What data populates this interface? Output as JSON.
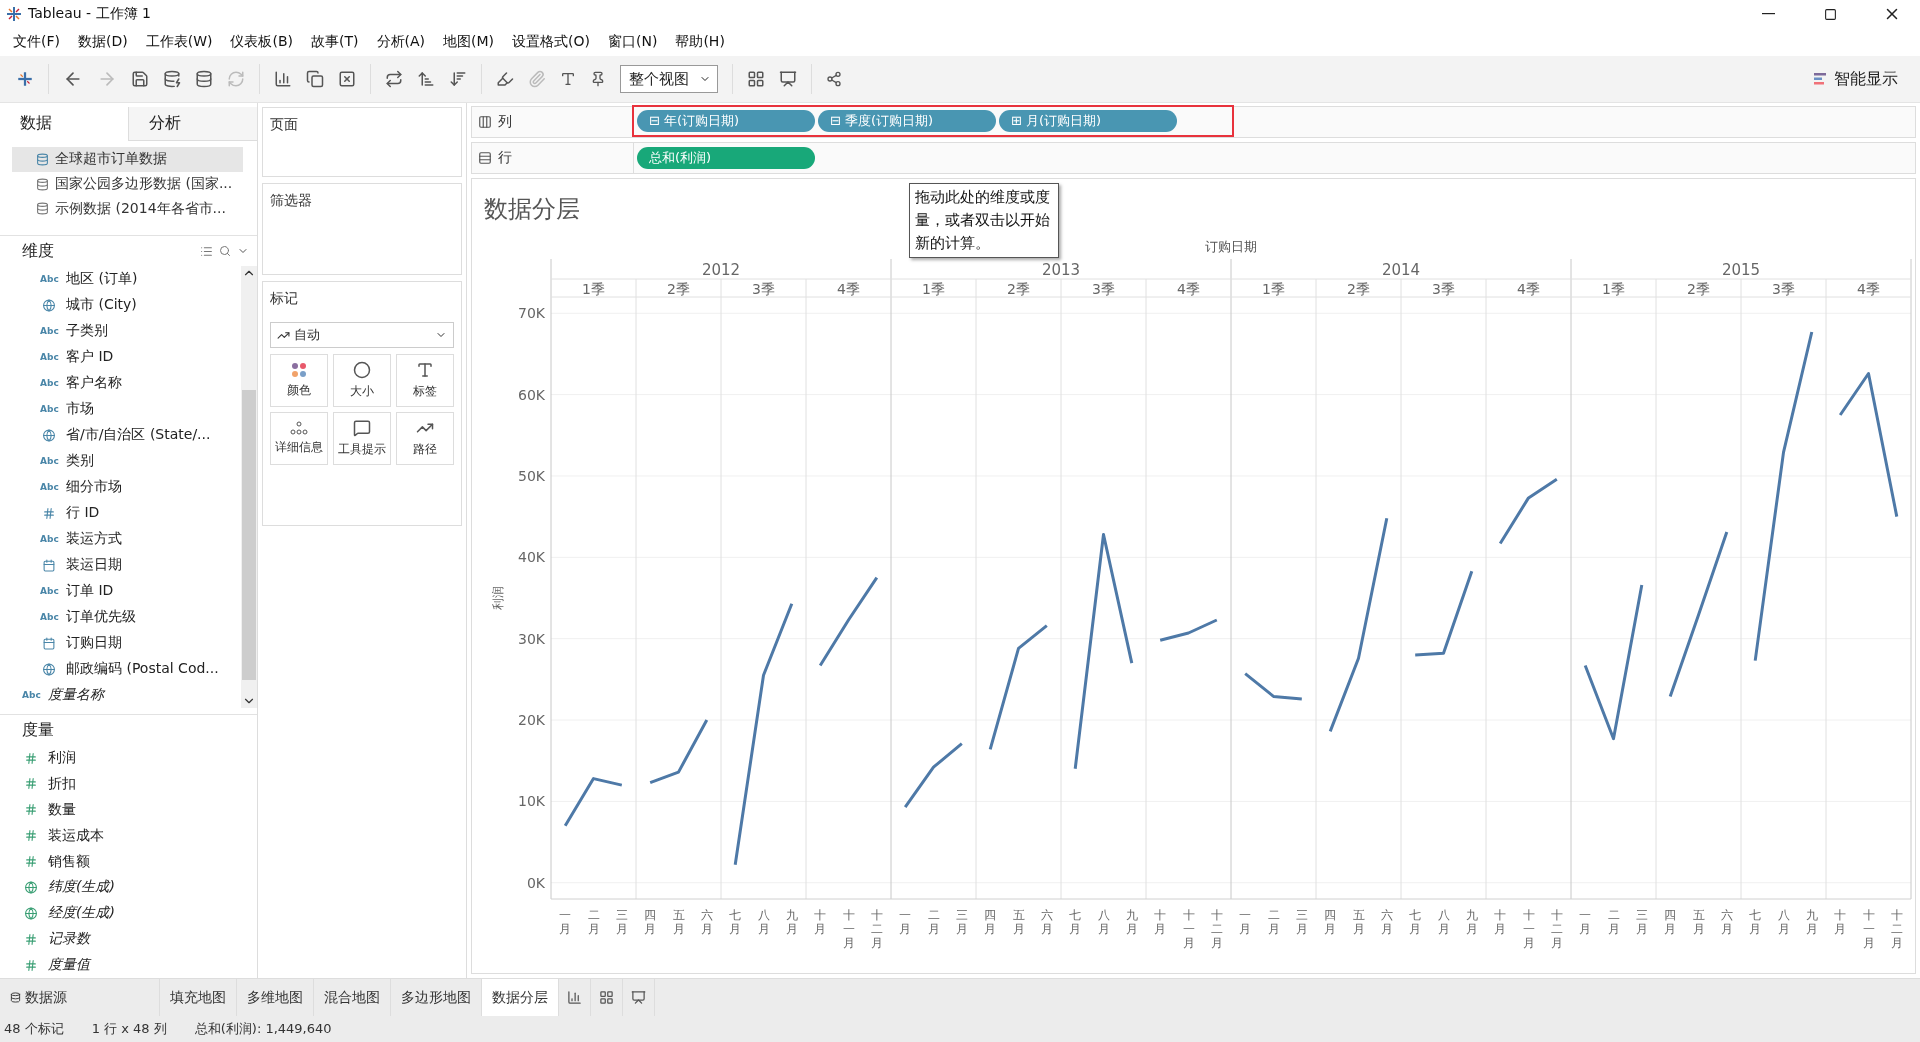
{
  "window": {
    "title": "Tableau - 工作簿 1"
  },
  "menu": [
    "文件(F)",
    "数据(D)",
    "工作表(W)",
    "仪表板(B)",
    "故事(T)",
    "分析(A)",
    "地图(M)",
    "设置格式(O)",
    "窗口(N)",
    "帮助(H)"
  ],
  "toolbar": {
    "fit": "整个视图",
    "show_me": "智能显示"
  },
  "data_pane": {
    "tabs": [
      {
        "label": "数据",
        "selected": true
      },
      {
        "label": "分析",
        "selected": false
      }
    ],
    "sources": [
      {
        "name": "全球超市订单数据",
        "selected": true
      },
      {
        "name": "国家公园多边形数据 (国家...",
        "selected": false
      },
      {
        "name": "示例数据 (2014年各省市...",
        "selected": false
      }
    ],
    "dimensions": {
      "title": "维度",
      "items": [
        {
          "name": "地区 (订单)",
          "kind": "abc",
          "type_text": "Abc",
          "generated": false
        },
        {
          "name": "城市 (City)",
          "kind": "geo",
          "generated": false
        },
        {
          "name": "子类别",
          "kind": "abc",
          "type_text": "Abc",
          "generated": false
        },
        {
          "name": "客户 ID",
          "kind": "abc",
          "type_text": "Abc",
          "generated": false
        },
        {
          "name": "客户名称",
          "kind": "abc",
          "type_text": "Abc",
          "generated": false
        },
        {
          "name": "市场",
          "kind": "abc",
          "type_text": "Abc",
          "generated": false
        },
        {
          "name": "省/市/自治区 (State/...",
          "kind": "geo",
          "generated": false
        },
        {
          "name": "类别",
          "kind": "abc",
          "type_text": "Abc",
          "generated": false
        },
        {
          "name": "细分市场",
          "kind": "abc",
          "type_text": "Abc",
          "generated": false
        },
        {
          "name": "行 ID",
          "kind": "number",
          "generated": false
        },
        {
          "name": "装运方式",
          "kind": "abc",
          "type_text": "Abc",
          "generated": false
        },
        {
          "name": "装运日期",
          "kind": "date",
          "generated": false
        },
        {
          "name": "订单 ID",
          "kind": "abc",
          "type_text": "Abc",
          "generated": false
        },
        {
          "name": "订单优先级",
          "kind": "abc",
          "type_text": "Abc",
          "generated": false
        },
        {
          "name": "订购日期",
          "kind": "date",
          "generated": false
        },
        {
          "name": "邮政编码 (Postal Cod...",
          "kind": "geo",
          "generated": false
        },
        {
          "name": "度量名称",
          "kind": "abc",
          "type_text": "Abc",
          "generated": true
        }
      ]
    },
    "measures": {
      "title": "度量",
      "items": [
        {
          "name": "利润",
          "kind": "number",
          "generated": false
        },
        {
          "name": "折扣",
          "kind": "number",
          "generated": false
        },
        {
          "name": "数量",
          "kind": "number",
          "generated": false
        },
        {
          "name": "装运成本",
          "kind": "number",
          "generated": false
        },
        {
          "name": "销售额",
          "kind": "number",
          "generated": false
        },
        {
          "name": "纬度(生成)",
          "kind": "geo",
          "generated": true
        },
        {
          "name": "经度(生成)",
          "kind": "geo",
          "generated": true
        },
        {
          "name": "记录数",
          "kind": "number",
          "generated": true
        },
        {
          "name": "度量值",
          "kind": "number",
          "generated": true
        }
      ]
    }
  },
  "cards": {
    "pages": {
      "title": "页面"
    },
    "filters": {
      "title": "筛选器"
    },
    "marks": {
      "title": "标记",
      "type": "自动",
      "buttons": [
        {
          "label": "颜色",
          "kind": "color"
        },
        {
          "label": "大小",
          "kind": "size"
        },
        {
          "label": "标签",
          "kind": "label"
        },
        {
          "label": "详细信息",
          "kind": "detail"
        },
        {
          "label": "工具提示",
          "kind": "tooltip"
        },
        {
          "label": "路径",
          "kind": "path"
        }
      ]
    }
  },
  "shelves": [
    {
      "label": "列",
      "kind": "columns",
      "highlighted": true,
      "pills": [
        {
          "icon": "⊟",
          "text": "年(订购日期)",
          "kind": "discrete"
        },
        {
          "icon": "⊟",
          "text": "季度(订购日期)",
          "kind": "discrete"
        },
        {
          "icon": "⊞",
          "text": "月(订购日期)",
          "kind": "discrete"
        }
      ]
    },
    {
      "label": "行",
      "kind": "rows",
      "highlighted": false,
      "pills": [
        {
          "text": "总和(利润)",
          "kind": "continuous"
        }
      ]
    }
  ],
  "tooltip": "拖动此处的维度或度量，或者双击以开始新的计算。",
  "view": {
    "title": "数据分层",
    "column_title": "订购日期",
    "years": [
      "2012",
      "2013",
      "2014",
      "2015"
    ],
    "quarters": [
      "1季",
      "2季",
      "3季",
      "4季",
      "1季",
      "2季",
      "3季",
      "4季",
      "1季",
      "2季",
      "3季",
      "4季",
      "1季",
      "2季",
      "3季",
      "4季"
    ],
    "chart_data": {
      "type": "line",
      "ylabel": "利润",
      "categories": [
        "一月",
        "二月",
        "三月",
        "四月",
        "五月",
        "六月",
        "七月",
        "八月",
        "九月",
        "十月",
        "十一月",
        "十二月",
        "一月",
        "二月",
        "三月",
        "四月",
        "五月",
        "六月",
        "七月",
        "八月",
        "九月",
        "十月",
        "十一月",
        "十二月",
        "一月",
        "二月",
        "三月",
        "四月",
        "五月",
        "六月",
        "七月",
        "八月",
        "九月",
        "十月",
        "十一月",
        "十二月",
        "一月",
        "二月",
        "三月",
        "四月",
        "五月",
        "六月",
        "七月",
        "八月",
        "九月",
        "十月",
        "十一月",
        "十二月"
      ],
      "series": [
        {
          "color": "#4e79a7",
          "values": [
            7000,
            12800,
            12000,
            12300,
            13600,
            20000,
            2200,
            25500,
            34300,
            26700,
            32300,
            37500,
            9300,
            14200,
            17100,
            16400,
            28800,
            31600,
            14000,
            42800,
            27000,
            29800,
            30700,
            32300,
            25700,
            22900,
            22600,
            18600,
            27600,
            44800,
            28000,
            28200,
            38300,
            41700,
            47300,
            49600,
            26700,
            17700,
            36600,
            22900,
            32900,
            43100,
            27300,
            52900,
            67700,
            57500,
            62600,
            45000
          ]
        }
      ],
      "ylim": [
        -2000,
        72000
      ],
      "grid": true,
      "yticks": [
        {
          "value": 0,
          "label": "0K"
        },
        {
          "value": 10000,
          "label": "10K"
        },
        {
          "value": 20000,
          "label": "20K"
        },
        {
          "value": 30000,
          "label": "30K"
        },
        {
          "value": 40000,
          "label": "40K"
        },
        {
          "value": 50000,
          "label": "50K"
        },
        {
          "value": 60000,
          "label": "60K"
        },
        {
          "value": 70000,
          "label": "70K"
        }
      ]
    }
  },
  "sheet_tabs": [
    {
      "label": "数据源",
      "kind": "source",
      "selected": false
    },
    {
      "label": "填充地图",
      "kind": "sheet",
      "selected": false
    },
    {
      "label": "多维地图",
      "kind": "sheet",
      "selected": false
    },
    {
      "label": "混合地图",
      "kind": "sheet",
      "selected": false
    },
    {
      "label": "多边形地图",
      "kind": "sheet",
      "selected": false
    },
    {
      "label": "数据分层",
      "kind": "sheet",
      "selected": true
    }
  ],
  "status": [
    "48 个标记",
    "1 行 x 48 列",
    "总和(利润): 1,449,640"
  ]
}
